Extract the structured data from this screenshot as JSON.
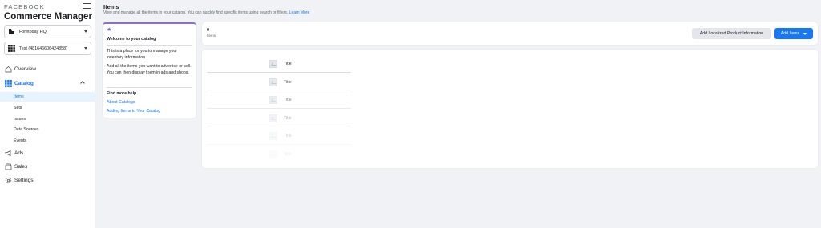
{
  "brand": {
    "top": "FACEBOOK",
    "title": "Commerce Manager"
  },
  "selectors": {
    "business": "Foretoday HQ",
    "catalog": "Test (481646606424858)"
  },
  "nav": {
    "overview": "Overview",
    "catalog": "Catalog",
    "catalog_sub": [
      "Items",
      "Sets",
      "Issues",
      "Data Sources",
      "Events"
    ],
    "ads": "Ads",
    "sales": "Sales",
    "settings": "Settings"
  },
  "header": {
    "title": "Items",
    "description": "View and manage all the items in your catalog. You can quickly find specific items using search or filters.",
    "learn_more": "Learn More"
  },
  "welcome": {
    "title": "Welcome to your catalog",
    "p1": "This is a place for you to manage your inventory information.",
    "p2": "Add all the items you want to advertise or sell. You can then display them in ads and shops.",
    "help_title": "Find more help",
    "link1": "About Catalogs",
    "link2": "Adding Items to Your Catalog"
  },
  "summary": {
    "count": "0",
    "count_label": "Items",
    "localized_button": "Add Localized Product Information",
    "add_button": "Add Items"
  },
  "item_rows": [
    {
      "label": "Title",
      "opacity": 1.0
    },
    {
      "label": "Title",
      "opacity": 0.85
    },
    {
      "label": "Title",
      "opacity": 0.6
    },
    {
      "label": "Title",
      "opacity": 0.4
    },
    {
      "label": "Title",
      "opacity": 0.22
    },
    {
      "label": "Title",
      "opacity": 0.1
    }
  ],
  "colors": {
    "accent": "#1877f2",
    "welcome_border": "#8b6fc7",
    "active_bg": "#e7f3ff"
  }
}
